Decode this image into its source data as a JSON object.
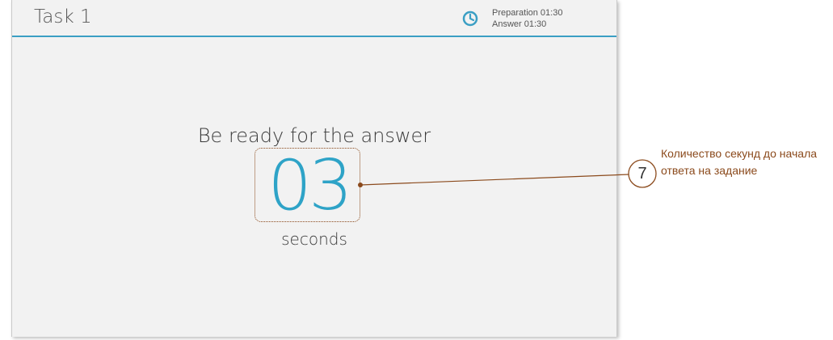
{
  "header": {
    "title": "Task 1",
    "timer_icon": "clock-icon",
    "preparation": "Preparation 01:30",
    "answer": "Answer 01:30"
  },
  "main": {
    "prompt": "Be ready for the answer",
    "countdown": "03",
    "unit": "seconds"
  },
  "annotation": {
    "number": "7",
    "text": "Количество секунд до начала ответа на задание"
  },
  "colors": {
    "accent": "#2ea3c7",
    "header_rule": "#3b9fc4",
    "annotation": "#8b4a1c",
    "background": "#f2f2f2"
  }
}
